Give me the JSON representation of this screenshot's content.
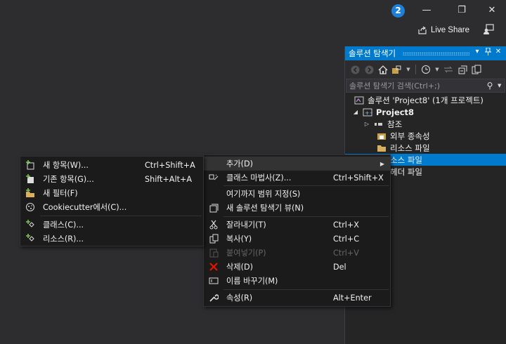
{
  "titlebar": {
    "notification_count": "2",
    "minimize_glyph": "—",
    "restore_glyph": "❐",
    "close_glyph": "✕",
    "live_share_label": "Live Share"
  },
  "solution_explorer": {
    "title": "솔루션 탐색기",
    "pin_glyph": "▾",
    "search_placeholder": "솔루션 탐색기 검색(Ctrl+;)",
    "tree": [
      {
        "label": "솔루션 'Project8' (1개 프로젝트)",
        "icon": "solution-icon",
        "selected": false
      },
      {
        "label": "Project8",
        "icon": "project-icon",
        "bold": true,
        "expanded": true
      },
      {
        "label": "참조",
        "icon": "references-icon",
        "collapsed": true
      },
      {
        "label": "외부 종속성",
        "icon": "external-dependencies-icon"
      },
      {
        "label": "리소스 파일",
        "icon": "folder-icon"
      },
      {
        "label": "소스 파일",
        "icon": "folder-icon",
        "selected": true
      },
      {
        "label": "헤더 파일",
        "icon": "folder-icon"
      }
    ]
  },
  "context_menu": {
    "items": [
      {
        "label": "추가(D)",
        "icon": "",
        "shortcut": "",
        "submenu": true,
        "highlighted": true
      },
      {
        "label": "클래스 마법사(Z)...",
        "icon": "class-wizard-icon",
        "shortcut": "Ctrl+Shift+X"
      },
      {
        "separator": true
      },
      {
        "label": "여기까지 범위 지정(S)",
        "icon": "",
        "shortcut": ""
      },
      {
        "label": "새 솔루션 탐색기 뷰(N)",
        "icon": "new-view-icon",
        "shortcut": ""
      },
      {
        "separator": true
      },
      {
        "label": "잘라내기(T)",
        "icon": "cut-icon",
        "shortcut": "Ctrl+X"
      },
      {
        "label": "복사(Y)",
        "icon": "copy-icon",
        "shortcut": "Ctrl+C"
      },
      {
        "label": "붙여넣기(P)",
        "icon": "paste-icon",
        "shortcut": "Ctrl+V",
        "disabled": true
      },
      {
        "label": "삭제(D)",
        "icon": "delete-icon",
        "shortcut": "Del"
      },
      {
        "label": "이름 바꾸기(M)",
        "icon": "rename-icon",
        "shortcut": ""
      },
      {
        "separator": true
      },
      {
        "label": "속성(R)",
        "icon": "properties-icon",
        "shortcut": "Alt+Enter"
      }
    ]
  },
  "add_submenu": {
    "items": [
      {
        "label": "새 항목(W)...",
        "icon": "new-item-icon",
        "shortcut": "Ctrl+Shift+A"
      },
      {
        "label": "기존 항목(G)...",
        "icon": "existing-item-icon",
        "shortcut": "Shift+Alt+A"
      },
      {
        "label": "새 필터(F)",
        "icon": "new-filter-icon",
        "shortcut": ""
      },
      {
        "label": "Cookiecutter에서(C)...",
        "icon": "cookiecutter-icon",
        "shortcut": ""
      },
      {
        "separator": true
      },
      {
        "label": "클래스(C)...",
        "icon": "class-icon",
        "shortcut": ""
      },
      {
        "label": "리소스(R)...",
        "icon": "resource-icon",
        "shortcut": ""
      }
    ]
  },
  "colors": {
    "accent": "#007acc",
    "background": "#2d2d30",
    "menu_bg": "#1b1b1c",
    "delete_red": "#e51400"
  }
}
